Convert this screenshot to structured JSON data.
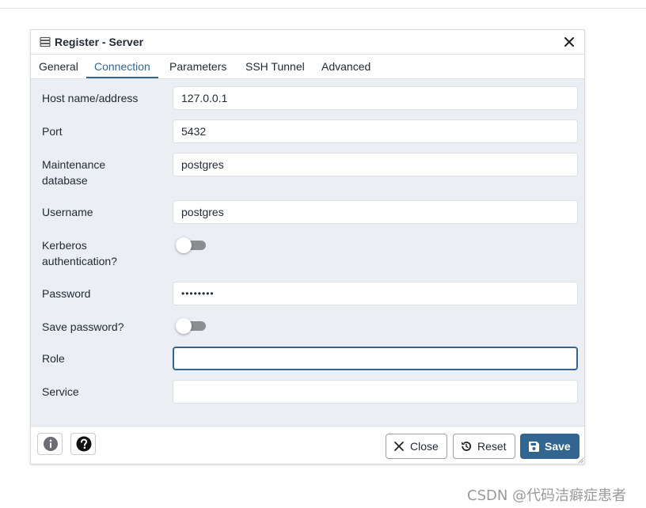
{
  "dialog": {
    "title": "Register - Server",
    "icon": "server-icon"
  },
  "tabs": [
    {
      "label": "General",
      "active": false
    },
    {
      "label": "Connection",
      "active": true
    },
    {
      "label": "Parameters",
      "active": false
    },
    {
      "label": "SSH Tunnel",
      "active": false
    },
    {
      "label": "Advanced",
      "active": false
    }
  ],
  "form": {
    "host": {
      "label": "Host name/address",
      "value": "127.0.0.1"
    },
    "port": {
      "label": "Port",
      "value": "5432"
    },
    "maintenance_db": {
      "label_line1": "Maintenance",
      "label_line2": "database",
      "value": "postgres"
    },
    "username": {
      "label": "Username",
      "value": "postgres"
    },
    "kerberos": {
      "label_line1": "Kerberos",
      "label_line2": "authentication?",
      "enabled": false
    },
    "password": {
      "label": "Password",
      "value": "••••••••"
    },
    "save_password": {
      "label": "Save password?",
      "enabled": false
    },
    "role": {
      "label": "Role",
      "value": ""
    },
    "service": {
      "label": "Service",
      "value": ""
    }
  },
  "footer": {
    "close_label": "Close",
    "reset_label": "Reset",
    "save_label": "Save"
  },
  "colors": {
    "accent": "#326690",
    "panel_bg": "#ebeef3",
    "toggle_off": "#8a8d91"
  },
  "watermark": "CSDN @代码洁癖症患者"
}
